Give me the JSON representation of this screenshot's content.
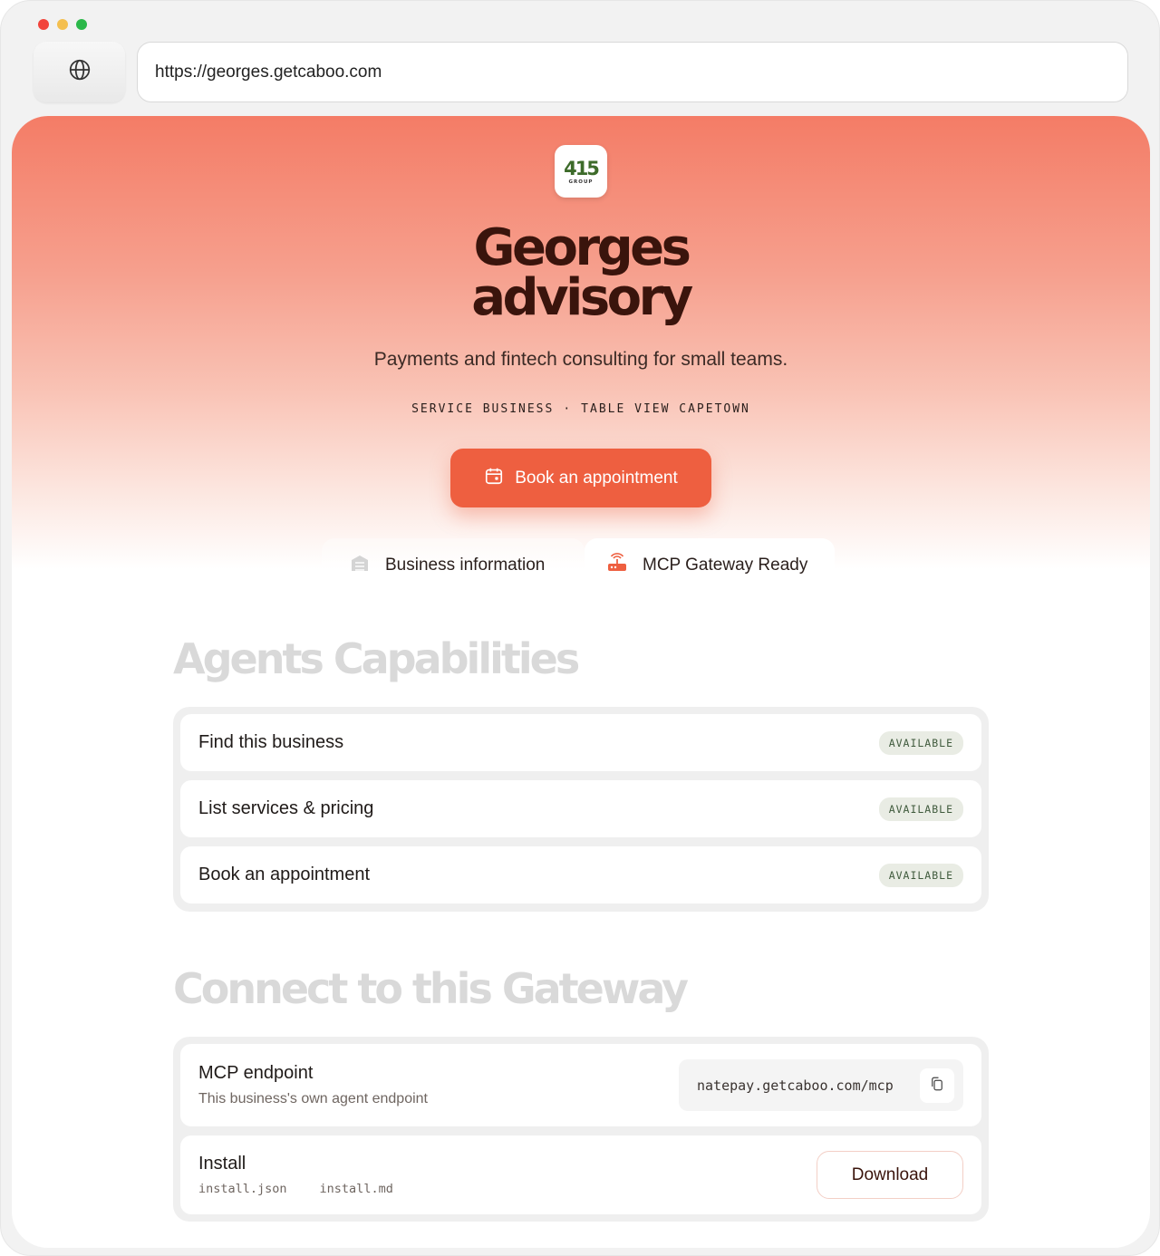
{
  "browser": {
    "url": "https://georges.getcaboo.com"
  },
  "business": {
    "logo_text": "415",
    "logo_subtext": "GROUP",
    "name_line1": "Georges",
    "name_line2": "advisory",
    "tagline": "Payments and fintech consulting for small teams.",
    "category": "SERVICE BUSINESS",
    "separator": "·",
    "location": "TABLE VIEW CAPETOWN",
    "cta_label": "Book an appointment"
  },
  "tabs": [
    {
      "label": "Business information",
      "icon": "building-icon"
    },
    {
      "label": "MCP Gateway Ready",
      "icon": "router-icon"
    }
  ],
  "capabilities": {
    "title": "Agents Capabilities",
    "items": [
      {
        "label": "Find this business",
        "status": "AVAILABLE"
      },
      {
        "label": "List services & pricing",
        "status": "AVAILABLE"
      },
      {
        "label": "Book an appointment",
        "status": "AVAILABLE"
      }
    ]
  },
  "gateway": {
    "title": "Connect to this Gateway",
    "endpoint": {
      "label": "MCP endpoint",
      "description": "This business's own agent endpoint",
      "value": "natepay.getcaboo.com/mcp"
    },
    "install": {
      "label": "Install",
      "files": [
        "install.json",
        "install.md"
      ],
      "button_label": "Download"
    }
  },
  "colors": {
    "accent": "#ee5f40",
    "title": "#3a140c",
    "badge_text": "#3f5a3c",
    "badge_bg": "#e9ece4"
  }
}
